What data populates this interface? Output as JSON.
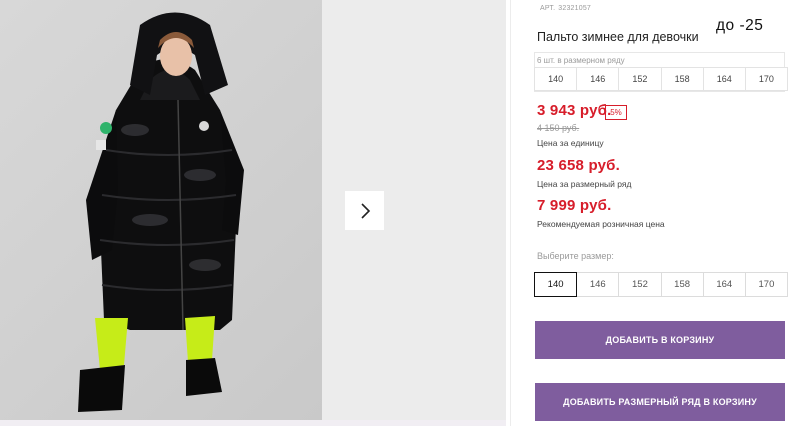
{
  "product": {
    "art_label": "АРТ.",
    "art_number": "32321057",
    "title": "Пальто зимнее для девочки",
    "promo_note": "до -25"
  },
  "size_row": {
    "label": "6 шт. в размерном ряду",
    "sizes": [
      "140",
      "146",
      "152",
      "158",
      "164",
      "170"
    ]
  },
  "pricing": {
    "unit_price": "3 943 руб.",
    "discount_badge": "5%",
    "old_price": "4 150 руб.",
    "unit_caption": "Цена за единицу",
    "row_price": "23 658 руб.",
    "row_caption": "Цена за размерный ряд",
    "retail_price": "7 999 руб.",
    "retail_caption": "Рекомендуемая розничная цена"
  },
  "size_select": {
    "label": "Выберите размер:",
    "options": [
      "140",
      "146",
      "152",
      "158",
      "164",
      "170"
    ],
    "selected": "140"
  },
  "actions": {
    "add_to_cart": "ДОБАВИТЬ В КОРЗИНУ",
    "add_row_to_cart": "ДОБАВИТЬ РАЗМЕРНЫЙ РЯД В КОРЗИНУ"
  },
  "colors": {
    "accent_button": "#7f5d9e",
    "price_red": "#d71d2a"
  },
  "icons": {
    "next": "chevron-right-icon"
  }
}
